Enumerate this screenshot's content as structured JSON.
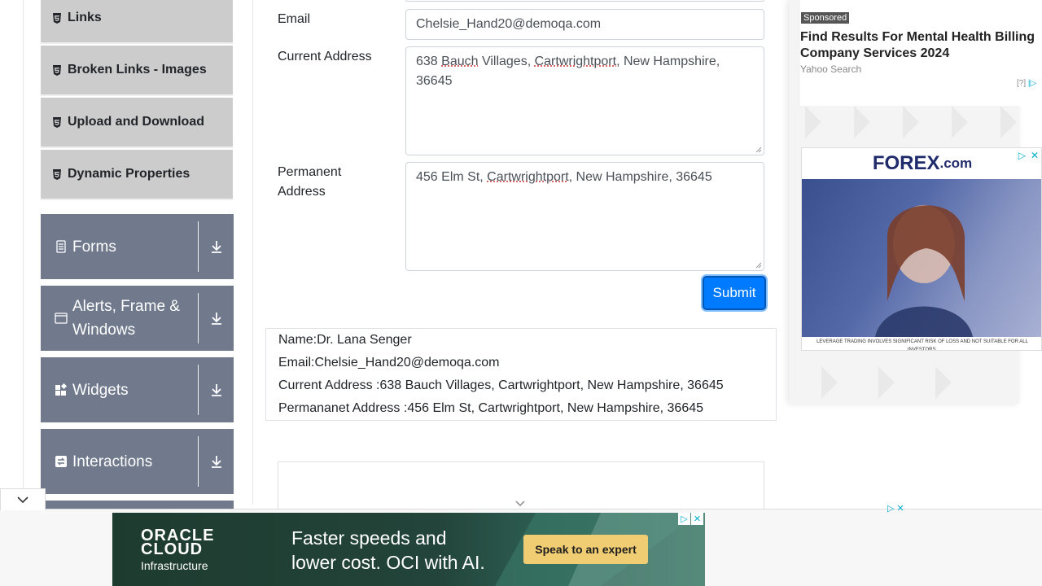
{
  "sidebar": {
    "elements_items": [
      {
        "label": "Links"
      },
      {
        "label": "Broken Links - Images"
      },
      {
        "label": "Upload and Download"
      },
      {
        "label": "Dynamic Properties"
      }
    ],
    "groups": [
      {
        "label": "Forms",
        "icon": "document-icon"
      },
      {
        "label": "Alerts, Frame & Windows",
        "icon": "window-icon"
      },
      {
        "label": "Widgets",
        "icon": "widgets-icon"
      },
      {
        "label": "Interactions",
        "icon": "interactions-icon"
      }
    ]
  },
  "form": {
    "email_label": "Email",
    "email_value": "Chelsie_Hand20@demoqa.com",
    "current_address_label": "Current Address",
    "current_address_parts": [
      "638 ",
      "Bauch",
      " Villages, ",
      "Cartwrightport",
      ", New Hampshire, 36645"
    ],
    "permanent_address_label": "Permanent Address",
    "permanent_address_parts": [
      "456 Elm St, ",
      "Cartwrightport",
      ", New Hampshire, 36645"
    ],
    "submit_label": "Submit"
  },
  "output": {
    "name": "Name:Dr. Lana Senger",
    "email": "Email:Chelsie_Hand20@demoqa.com",
    "current_address": "Current Address :638 Bauch Villages, Cartwrightport, New Hampshire, 36645",
    "permanent_address": "Permananet Address :456 Elm St, Cartwrightport, New Hampshire, 36645"
  },
  "ads": {
    "sponsored": "Sponsored",
    "headline": "Find Results For Mental Health Billing Company Services 2024",
    "source": "Yahoo Search",
    "help": "[?]",
    "forex_logo": "FOREX",
    "forex_logo_suffix": ".com",
    "forex_disclaimer": "LEVERAGE TRADING INVOLVES SIGNIFICANT RISK OF LOSS AND NOT SUITABLE FOR ALL INVESTORS.",
    "oracle_logo_line1": "ORACLE",
    "oracle_logo_line2": "CLOUD",
    "oracle_logo_line3": "Infrastructure",
    "oracle_text_line1": "Faster speeds and",
    "oracle_text_line2": "lower cost. OCI with AI.",
    "oracle_cta": "Speak to an expert"
  },
  "colors": {
    "accent": "#007bff",
    "group_bg": "#707a8c",
    "menu_item_bg": "#cccccc"
  }
}
